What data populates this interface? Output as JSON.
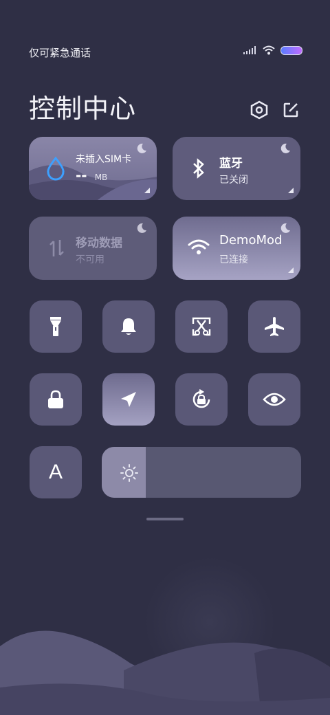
{
  "status_bar": {
    "carrier_text": "仅可紧急通话"
  },
  "header": {
    "title": "控制中心"
  },
  "tiles": {
    "sim": {
      "title": "未插入SIM卡",
      "value": "--",
      "unit": "MB"
    },
    "bluetooth": {
      "title": "蓝牙",
      "status": "已关闭"
    },
    "mobile_data": {
      "title": "移动数据",
      "status": "不可用"
    },
    "wifi": {
      "title": "DemoMod",
      "status": "已连接"
    }
  },
  "toggles": [
    {
      "icon": "flashlight-icon",
      "active": false
    },
    {
      "icon": "bell-icon",
      "active": false
    },
    {
      "icon": "screenshot-icon",
      "active": false
    },
    {
      "icon": "airplane-icon",
      "active": false
    },
    {
      "icon": "lock-icon",
      "active": false
    },
    {
      "icon": "location-icon",
      "active": true
    },
    {
      "icon": "auto-rotate-lock-icon",
      "active": false
    },
    {
      "icon": "eye-icon",
      "active": false
    },
    {
      "icon": "auto-brightness-icon",
      "label": "A"
    }
  ],
  "brightness": {
    "level": 0.22,
    "icon": "sun-icon"
  },
  "colors": {
    "background": "#2f2f45",
    "tile": "#5a5877",
    "active_tile": "#9a97b8"
  }
}
